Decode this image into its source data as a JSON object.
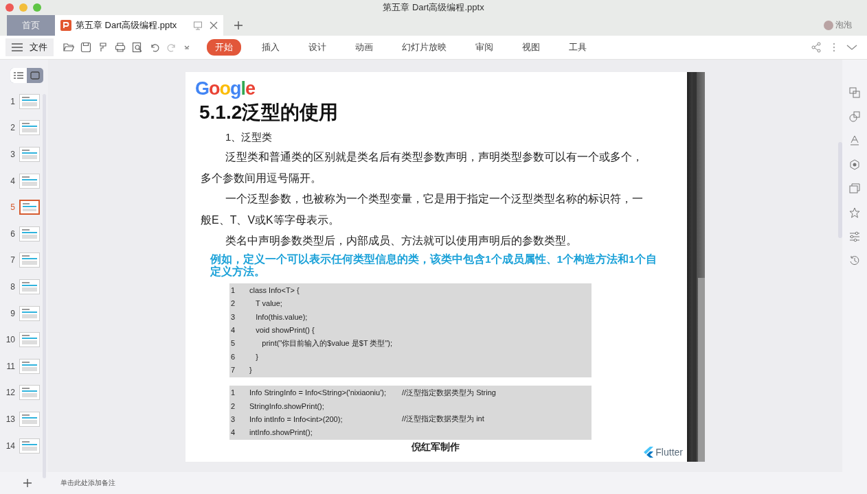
{
  "window": {
    "title": "第五章 Dart高级编程.pptx"
  },
  "tabs": [
    {
      "label": "首页",
      "kind": "home",
      "selected": false
    },
    {
      "label": "第五章 Dart高级编程.pptx",
      "kind": "doc",
      "selected": true
    }
  ],
  "user": {
    "name": "泡泡"
  },
  "toolbar": {
    "file_menu": "文件"
  },
  "ribbon_tabs": [
    {
      "label": "开始",
      "selected": true
    },
    {
      "label": "插入",
      "selected": false
    },
    {
      "label": "设计",
      "selected": false
    },
    {
      "label": "动画",
      "selected": false
    },
    {
      "label": "幻灯片放映",
      "selected": false
    },
    {
      "label": "审阅",
      "selected": false
    },
    {
      "label": "视图",
      "selected": false
    },
    {
      "label": "工具",
      "selected": false
    }
  ],
  "thumbnails": [
    {
      "number": "1",
      "selected": false
    },
    {
      "number": "2",
      "selected": false
    },
    {
      "number": "3",
      "selected": false
    },
    {
      "number": "4",
      "selected": false
    },
    {
      "number": "5",
      "selected": true
    },
    {
      "number": "6",
      "selected": false
    },
    {
      "number": "7",
      "selected": false
    },
    {
      "number": "8",
      "selected": false
    },
    {
      "number": "9",
      "selected": false
    },
    {
      "number": "10",
      "selected": false
    },
    {
      "number": "11",
      "selected": false
    },
    {
      "number": "12",
      "selected": false
    },
    {
      "number": "13",
      "selected": false
    },
    {
      "number": "14",
      "selected": false
    }
  ],
  "slide": {
    "logo": "Google",
    "title": "5.1.2泛型的使用",
    "heading": "1、泛型类",
    "paragraphs": [
      "泛型类和普通类的区别就是类名后有类型参数声明，声明类型参数可以有一个或多个，多个参数间用逗号隔开。",
      "一个泛型参数，也被称为一个类型变量，它是用于指定一个泛型类型名称的标识符，一般E、T、V或K等字母表示。",
      "类名中声明参数类型后，内部成员、方法就可以使用声明后的参数类型。"
    ],
    "highlight": "例如，定义一个可以表示任何类型信息的类，该类中包含1个成员属性、1个构造方法和1个自定义方法。",
    "code_blocks": [
      [
        {
          "number": "1",
          "code": "class Info<T> {"
        },
        {
          "number": "2",
          "code": "   T value;"
        },
        {
          "number": "3",
          "code": "   Info(this.value);"
        },
        {
          "number": "4",
          "code": "   void showPrint() {"
        },
        {
          "number": "5",
          "code": "      print(\"你目前输入的$value 是$T 类型\");"
        },
        {
          "number": "6",
          "code": "   }"
        },
        {
          "number": "7",
          "code": "}"
        }
      ],
      [
        {
          "number": "1",
          "code": "Info StringInfo = Info<String>('nixiaoniu');",
          "comment": "//泛型指定数据类型为 String"
        },
        {
          "number": "2",
          "code": "StringInfo.showPrint();"
        },
        {
          "number": "3",
          "code": "Info intInfo = Info<int>(200);",
          "comment": "//泛型指定数据类型为 int"
        },
        {
          "number": "4",
          "code": "intInfo.showPrint();"
        }
      ]
    ],
    "author": "倪红军制作",
    "brand": "Flutter"
  },
  "status_bar": {
    "notes_placeholder": "单击此处添加备注"
  }
}
